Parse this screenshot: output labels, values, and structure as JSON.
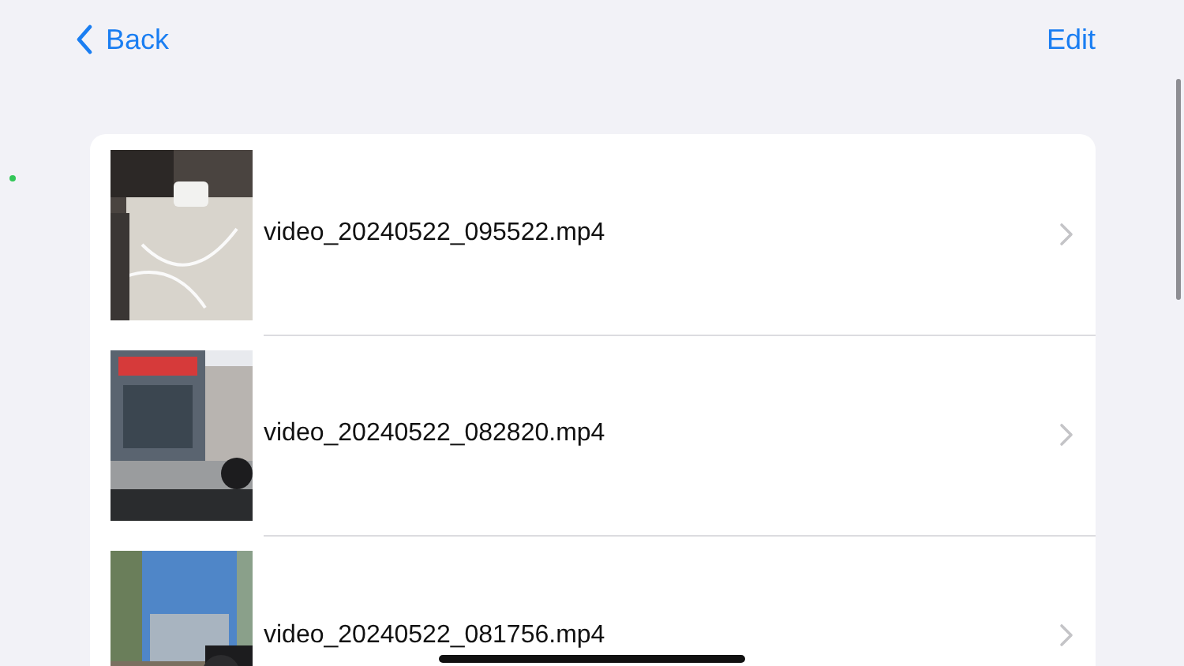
{
  "nav": {
    "back": "Back",
    "edit": "Edit"
  },
  "videos": [
    {
      "name": "video_20240522_095522.mp4"
    },
    {
      "name": "video_20240522_082820.mp4"
    },
    {
      "name": "video_20240522_081756.mp4"
    }
  ]
}
